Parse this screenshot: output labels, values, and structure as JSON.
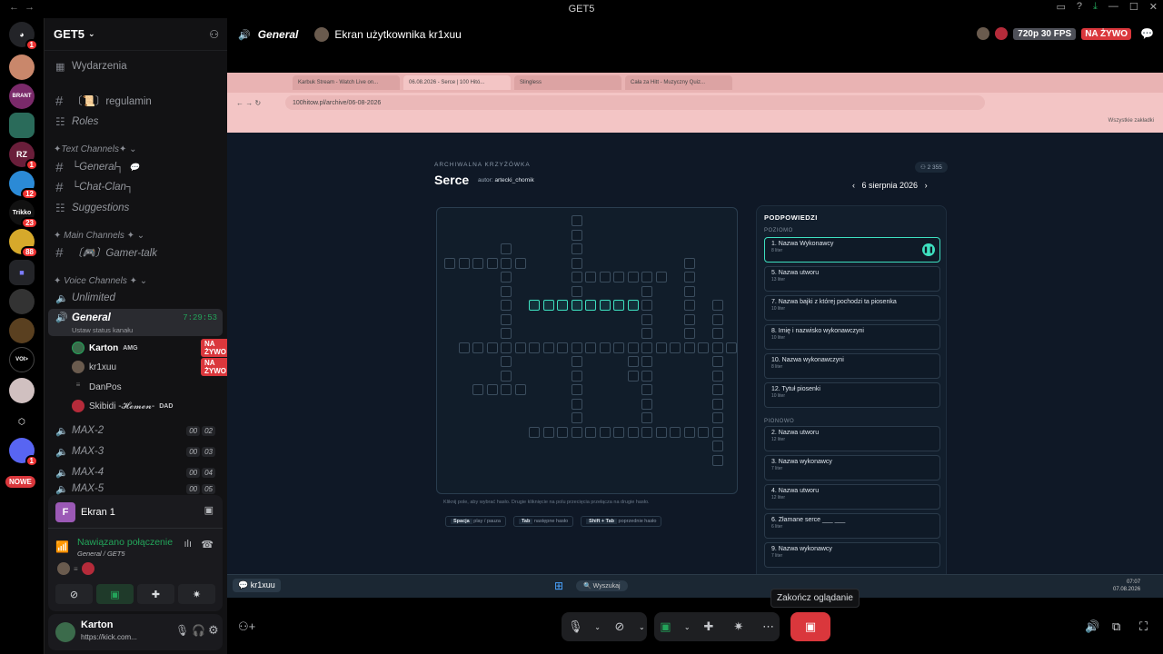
{
  "window": {
    "title": "GET5"
  },
  "guilds": [
    {
      "badge": "1"
    },
    {
      "badge": ""
    },
    {
      "badge": ""
    },
    {
      "badge": ""
    },
    {
      "badge": "1"
    },
    {
      "badge": "12"
    },
    {
      "badge": "23"
    },
    {
      "badge": "88"
    },
    {
      "badge": ""
    },
    {
      "badge": ""
    },
    {
      "badge": ""
    },
    {
      "badge": ""
    },
    {
      "badge": ""
    },
    {
      "badge": ""
    },
    {
      "badge": "1"
    }
  ],
  "guild_labels": {
    "brant": "BRANT",
    "rz": "RZ",
    "trikko": "Trikko",
    "voi": "VOI>",
    "nowe": "NOWE"
  },
  "server": {
    "name": "GET5"
  },
  "sidebar": {
    "events": "Wydarzenia",
    "channels_top": [
      {
        "name": "〔📜〕regulamin"
      },
      {
        "name": "Roles"
      }
    ],
    "cat_text": "✦Text Channels✦",
    "text_channels": [
      {
        "name": "└General┐"
      },
      {
        "name": "└Chat-Clan┐"
      },
      {
        "name": "Suggestions"
      }
    ],
    "cat_main": "✦ Main Channels ✦",
    "main_channels": [
      {
        "name": "〔🎮〕Gamer-talk"
      }
    ],
    "cat_voice": "✦ Voice Channels ✦",
    "voice_unlimited": "Unlimited",
    "voice_general": "General",
    "voice_general_time": "7:29:53",
    "voice_status": "Ustaw status kanału",
    "voice_users": [
      {
        "name": "Karton",
        "tag": "AMG",
        "live": "NA ŻYWO"
      },
      {
        "name": "kr1xuu",
        "tag": "",
        "live": "NA ŻYWO"
      },
      {
        "name": "DanPos",
        "tag": "",
        "live": ""
      },
      {
        "name": "Skibidi -𝓗𝓮𝓶𝓮𝓷-",
        "tag": "DAD",
        "live": ""
      }
    ],
    "voice_max": [
      {
        "name": "MAX-2",
        "a": "00",
        "b": "02"
      },
      {
        "name": "MAX-3",
        "a": "00",
        "b": "03"
      },
      {
        "name": "MAX-4",
        "a": "00",
        "b": "04"
      },
      {
        "name": "MAX-5",
        "a": "00",
        "b": "05"
      }
    ]
  },
  "panel": {
    "screen": "Ekran 1",
    "connected": "Nawiązano połączenie",
    "channel": "General",
    "server": "GET5"
  },
  "user": {
    "name": "Karton",
    "status": "https://kick.com..."
  },
  "top": {
    "channel": "General",
    "title": "Ekran użytkownika kr1xuu",
    "quality": "720p 30 FPS",
    "live": "NA ŻYWO"
  },
  "browser": {
    "tabs": [
      "Karbuk Stream - Watch Live on...",
      "06.08.2026 - Serce | 100 Hitó...",
      "Slingless",
      "Cała za Hitt - Muzyczny Quiz..."
    ],
    "url": "100hitow.pl/archive/06-08-2026",
    "bookmarks": "Wszystkie zakładki"
  },
  "game": {
    "kicker": "ARCHIWALNA KRZYŻÓWKA",
    "title": "Serce",
    "author_label": "autor:",
    "author": "artecki_chomik",
    "date": "6 sierpnia 2026",
    "players": "2 355",
    "hint": "Kliknij pole, aby wybrać hasło. Drugie kliknięcie na polu przecięcia przełącza na drugie hasło.",
    "keys": [
      {
        "k": "Spacja",
        "d": "play / pauza"
      },
      {
        "k": "Tab",
        "d": "następne hasło"
      },
      {
        "k": "Shift + Tab",
        "d": "poprzednie hasło"
      }
    ],
    "clues_title": "PODPOWIEDZI",
    "across_label": "POZIOMO",
    "down_label": "PIONOWO",
    "across": [
      {
        "t": "1. Nazwa Wykonawcy",
        "s": "8 liter"
      },
      {
        "t": "5. Nazwa utworu",
        "s": "13 liter"
      },
      {
        "t": "7. Nazwa bajki z której pochodzi ta piosenka",
        "s": "10 liter"
      },
      {
        "t": "8. Imię i nazwisko wykonawczyni",
        "s": "10 liter"
      },
      {
        "t": "10. Nazwa wykonawczyni",
        "s": "8 liter"
      },
      {
        "t": "12. Tytuł piosenki",
        "s": "10 liter"
      }
    ],
    "down": [
      {
        "t": "2. Nazwa utworu",
        "s": "12 liter"
      },
      {
        "t": "3. Nazwa wykonawcy",
        "s": "7 liter"
      },
      {
        "t": "4. Nazwa utworu",
        "s": "12 liter"
      },
      {
        "t": "6. Złamane serce ___ ___",
        "s": "6 liter"
      },
      {
        "t": "9. Nazwa wykonawcy",
        "s": "7 liter"
      }
    ],
    "taskbar_search": "Wyszukaj",
    "taskbar_time": "07:07",
    "taskbar_date": "07.08.2026"
  },
  "stream_label": "kr1xuu",
  "tooltip": "Zakończ oglądanie",
  "colors": {
    "accent": "#3ee0c0",
    "live": "#da373c",
    "green": "#23a55a"
  }
}
